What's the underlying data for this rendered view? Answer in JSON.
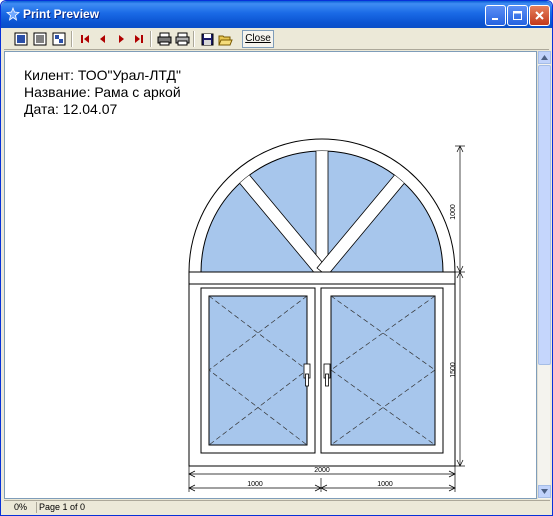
{
  "window": {
    "title": "Print Preview"
  },
  "toolbar": {
    "close_label": "Close",
    "buttons": [
      "one-page-icon",
      "two-page-icon",
      "page-setup-icon",
      "first-page-icon",
      "prev-page-icon",
      "next-page-icon",
      "last-page-icon",
      "print-setup-icon",
      "print-icon",
      "save-icon",
      "open-icon"
    ]
  },
  "document": {
    "client_line": "Килент: ТОО\"Урал-ЛТД\"",
    "name_line": "Название: Рама с аркой",
    "date_line": "Дата: 12.04.07"
  },
  "dimensions": {
    "arch_height": "1000",
    "lower_height": "1500",
    "total_width": "2000",
    "left_width": "1000",
    "right_width": "1000"
  },
  "colors": {
    "glass": "#a7c6ec",
    "title_bar": "#0a54d2"
  },
  "status": {
    "zoom": "0%",
    "page": "Page 1 of 0"
  }
}
